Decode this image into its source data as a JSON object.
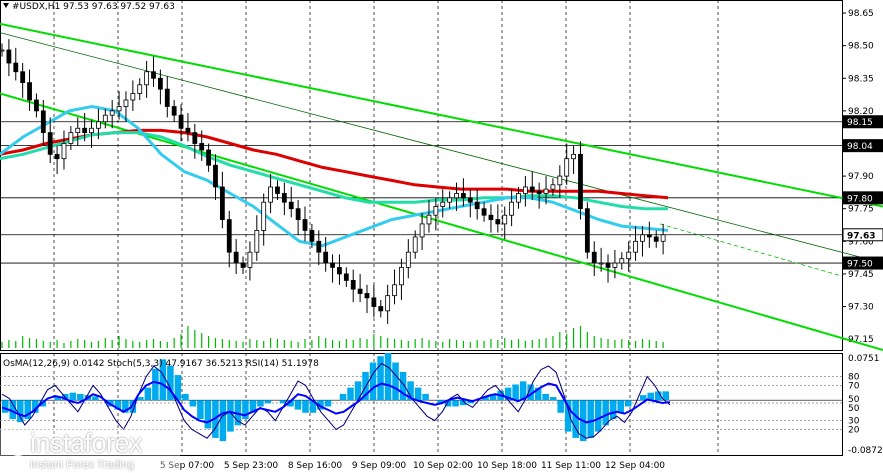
{
  "header": {
    "symbol_line": "#USDX,H1  97.53 97.63 97.52 97.63",
    "indicator_line": "OsMA(12,26,9) 0.0142  Stoch(5,3,3) 47.9167 36.5213  RSI(14) 51.1978"
  },
  "logo": {
    "name": "instaforex",
    "tagline": "Instant Forex Trading"
  },
  "colors": {
    "background": "#ffffff",
    "candles": "#000000",
    "channel": "#00dd00",
    "ma_red": "#dd0000",
    "ma_teal": "#22ddaa",
    "ma_cyan": "#33ccee",
    "osma_bars": "#00aaee",
    "stoch_line": "#000080",
    "rsi_line": "#0000ff",
    "grid": "#000000"
  },
  "chart_data": [
    {
      "type": "candlestick",
      "title": "#USDX,H1",
      "ylim": [
        97.15,
        98.7
      ],
      "y_ticks": [
        "98.65",
        "98.50",
        "98.35",
        "98.20",
        "98.05",
        "97.90",
        "97.75",
        "97.60",
        "97.45",
        "97.30",
        "97.15"
      ],
      "price_tags": [
        "98.15",
        "98.04",
        "97.80",
        "97.63",
        "97.50"
      ],
      "x_ticks": [
        "5 Sep 07:00",
        "5 Sep 23:00",
        "8 Sep 16:00",
        "9 Sep 09:00",
        "10 Sep 02:00",
        "10 Sep 18:00",
        "11 Sep 11:00",
        "12 Sep 04:00"
      ],
      "hlines": [
        98.15,
        98.04,
        97.8,
        97.63,
        97.5
      ],
      "close_series": [
        98.48,
        98.42,
        98.38,
        98.33,
        98.25,
        98.2,
        98.1,
        98.0,
        97.98,
        98.05,
        98.1,
        98.12,
        98.1,
        98.12,
        98.15,
        98.18,
        98.2,
        98.22,
        98.25,
        98.28,
        98.32,
        98.38,
        98.35,
        98.3,
        98.22,
        98.18,
        98.12,
        98.1,
        98.05,
        98.02,
        97.95,
        97.85,
        97.7,
        97.55,
        97.5,
        97.48,
        97.55,
        97.65,
        97.78,
        97.85,
        97.82,
        97.78,
        97.75,
        97.7,
        97.65,
        97.6,
        97.55,
        97.5,
        97.48,
        97.45,
        97.42,
        97.38,
        97.36,
        97.34,
        97.3,
        97.28,
        97.35,
        97.4,
        97.48,
        97.55,
        97.62,
        97.68,
        97.72,
        97.76,
        97.78,
        97.8,
        97.82,
        97.8,
        97.78,
        97.75,
        97.72,
        97.7,
        97.68,
        97.72,
        97.78,
        97.82,
        97.85,
        97.83,
        97.82,
        97.84,
        97.86,
        97.9,
        97.98,
        98.0,
        97.75,
        97.55,
        97.5,
        97.5,
        97.48,
        97.5,
        97.52,
        97.55,
        97.6,
        97.63,
        97.62,
        97.6,
        97.63
      ],
      "volume_series": [
        6,
        8,
        7,
        12,
        10,
        9,
        7,
        6,
        8,
        5,
        7,
        9,
        8,
        6,
        7,
        10,
        8,
        12,
        9,
        7,
        6,
        8,
        9,
        7,
        6,
        10,
        14,
        22,
        18,
        15,
        12,
        10,
        9,
        8,
        7,
        6,
        9,
        8,
        7,
        10,
        9,
        8,
        7,
        6,
        9,
        8,
        12,
        10,
        8,
        7,
        9,
        8,
        10,
        9,
        14,
        12,
        10,
        9,
        8,
        7,
        9,
        10,
        8,
        7,
        6,
        9,
        8,
        7,
        6,
        8,
        7,
        9,
        8,
        10,
        8,
        9,
        7,
        8,
        9,
        10,
        12,
        16,
        14,
        20,
        22,
        16,
        12,
        10,
        9,
        8,
        9,
        8,
        7,
        9,
        8,
        7,
        6
      ],
      "series": [
        {
          "name": "channel-upper",
          "points": [
            [
              0,
              98.6
            ],
            [
              883,
              97.76
            ]
          ]
        },
        {
          "name": "channel-lower",
          "points": [
            [
              0,
              98.28
            ],
            [
              883,
              97.1
            ]
          ]
        },
        {
          "name": "channel-mid",
          "points": [
            [
              0,
              98.56
            ],
            [
              883,
              97.5
            ]
          ]
        },
        {
          "name": "ma-red",
          "values": [
            98.0,
            98.02,
            98.05,
            98.07,
            98.09,
            98.1,
            98.11,
            98.11,
            98.1,
            98.08,
            98.05,
            98.02,
            98.0,
            97.97,
            97.94,
            97.92,
            97.9,
            97.88,
            97.86,
            97.85,
            97.84,
            97.84,
            97.84,
            97.83,
            97.83,
            97.83,
            97.83,
            97.82,
            97.81,
            97.8
          ]
        },
        {
          "name": "ma-teal",
          "values": [
            97.98,
            98.0,
            98.03,
            98.06,
            98.09,
            98.1,
            98.1,
            98.08,
            98.04,
            97.99,
            97.95,
            97.92,
            97.89,
            97.86,
            97.83,
            97.8,
            97.78,
            97.78,
            97.78,
            97.79,
            97.79,
            97.8,
            97.8,
            97.81,
            97.81,
            97.8,
            97.78,
            97.76,
            97.75,
            97.75
          ]
        },
        {
          "name": "ma-cyan",
          "values": [
            98.0,
            98.08,
            98.14,
            98.2,
            98.22,
            98.2,
            98.12,
            98.0,
            97.92,
            97.88,
            97.82,
            97.76,
            97.68,
            97.6,
            97.58,
            97.62,
            97.66,
            97.7,
            97.72,
            97.74,
            97.76,
            97.78,
            97.8,
            97.8,
            97.78,
            97.74,
            97.7,
            97.67,
            97.66,
            97.65
          ]
        }
      ]
    },
    {
      "type": "oscillator",
      "title": "OsMA(12,26,9) 0.0142  Stoch(5,3,3) 47.9167 36.5213  RSI(14) 51.1978",
      "y_ticks": [
        "0.0751",
        "80",
        "70",
        "50",
        "50",
        "30",
        "20",
        "-0.0872"
      ],
      "osma": [
        -0.02,
        -0.03,
        -0.035,
        -0.03,
        -0.02,
        -0.01,
        0.0,
        0.005,
        0.01,
        0.012,
        0.01,
        0.008,
        0.006,
        0.0,
        -0.01,
        -0.015,
        -0.02,
        -0.02,
        0.005,
        0.02,
        0.05,
        0.065,
        0.055,
        0.04,
        0.01,
        -0.01,
        -0.03,
        -0.045,
        -0.06,
        -0.065,
        -0.05,
        -0.04,
        -0.03,
        -0.02,
        -0.01,
        -0.005,
        0.0,
        -0.005,
        -0.01,
        -0.015,
        -0.02,
        -0.02,
        -0.015,
        -0.01,
        0.0,
        0.01,
        0.02,
        0.03,
        0.045,
        0.06,
        0.07,
        0.075,
        0.06,
        0.045,
        0.03,
        0.02,
        0.01,
        0.0,
        -0.005,
        -0.01,
        -0.01,
        -0.008,
        -0.005,
        0.0,
        0.005,
        0.01,
        0.015,
        0.02,
        0.025,
        0.03,
        0.025,
        0.02,
        0.01,
        0.005,
        -0.02,
        -0.05,
        -0.06,
        -0.065,
        -0.06,
        -0.05,
        -0.04,
        -0.03,
        -0.02,
        -0.01,
        0.0,
        0.008,
        0.012,
        0.014,
        0.014
      ],
      "stoch": [
        60,
        55,
        40,
        25,
        35,
        50,
        65,
        70,
        60,
        50,
        40,
        55,
        70,
        60,
        45,
        30,
        20,
        35,
        60,
        80,
        92,
        85,
        70,
        50,
        30,
        20,
        15,
        10,
        20,
        35,
        40,
        30,
        25,
        35,
        45,
        40,
        30,
        45,
        60,
        75,
        70,
        55,
        40,
        30,
        20,
        25,
        40,
        55,
        70,
        85,
        95,
        90,
        80,
        70,
        55,
        45,
        35,
        30,
        40,
        55,
        60,
        50,
        45,
        55,
        65,
        70,
        60,
        50,
        40,
        55,
        75,
        88,
        92,
        85,
        60,
        30,
        15,
        10,
        12,
        20,
        30,
        35,
        28,
        40,
        60,
        80,
        70,
        55,
        48
      ],
      "rsi": [
        45,
        42,
        38,
        35,
        40,
        48,
        55,
        58,
        56,
        52,
        50,
        54,
        60,
        57,
        50,
        45,
        40,
        45,
        60,
        70,
        74,
        72,
        66,
        55,
        42,
        35,
        30,
        28,
        32,
        38,
        40,
        38,
        36,
        40,
        44,
        42,
        40,
        45,
        52,
        60,
        58,
        52,
        46,
        42,
        38,
        40,
        46,
        52,
        60,
        68,
        72,
        70,
        66,
        60,
        55,
        52,
        50,
        48,
        50,
        54,
        56,
        54,
        52,
        55,
        58,
        60,
        58,
        55,
        52,
        56,
        62,
        68,
        72,
        70,
        55,
        40,
        32,
        28,
        30,
        34,
        38,
        40,
        38,
        42,
        48,
        54,
        52,
        50,
        51
      ]
    }
  ]
}
